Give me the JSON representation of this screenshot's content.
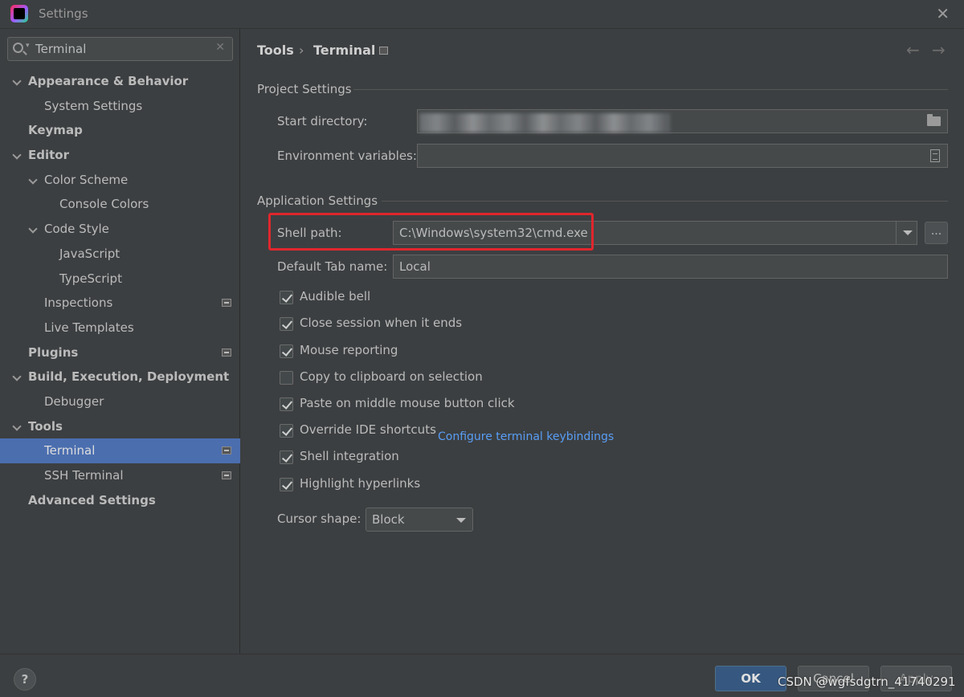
{
  "window": {
    "title": "Settings",
    "close_glyph": "✕"
  },
  "search": {
    "value": "Terminal",
    "placeholder": "",
    "clear_glyph": "✕"
  },
  "tree": [
    {
      "label": "Appearance & Behavior",
      "expanded": true
    },
    {
      "label": "System Settings"
    },
    {
      "label": "Keymap"
    },
    {
      "label": "Editor",
      "expanded": true
    },
    {
      "label": "Color Scheme",
      "expanded": true
    },
    {
      "label": "Console Colors"
    },
    {
      "label": "Code Style",
      "expanded": true
    },
    {
      "label": "JavaScript"
    },
    {
      "label": "TypeScript"
    },
    {
      "label": "Inspections"
    },
    {
      "label": "Live Templates"
    },
    {
      "label": "Plugins"
    },
    {
      "label": "Build, Execution, Deployment",
      "expanded": true
    },
    {
      "label": "Debugger"
    },
    {
      "label": "Tools",
      "expanded": true
    },
    {
      "label": "Terminal",
      "selected": true
    },
    {
      "label": "SSH Terminal"
    },
    {
      "label": "Advanced Settings"
    }
  ],
  "breadcrumb": {
    "parent": "Tools",
    "separator": "›",
    "current": "Terminal",
    "back_glyph": "←",
    "forward_glyph": "→"
  },
  "project_settings": {
    "title": "Project Settings",
    "start_directory_label": "Start directory:",
    "start_directory_value": "",
    "env_vars_label": "Environment variables:",
    "env_vars_value": ""
  },
  "app_settings": {
    "title": "Application Settings",
    "shell_path_label": "Shell path:",
    "shell_path_value": "C:\\Windows\\system32\\cmd.exe",
    "browse_label": "...",
    "default_tab_label": "Default Tab name:",
    "default_tab_value": "Local",
    "checkboxes": [
      {
        "label": "Audible bell",
        "checked": true
      },
      {
        "label": "Close session when it ends",
        "checked": true
      },
      {
        "label": "Mouse reporting",
        "checked": true
      },
      {
        "label": "Copy to clipboard on selection",
        "checked": false
      },
      {
        "label": "Paste on middle mouse button click",
        "checked": true
      },
      {
        "label": "Override IDE shortcuts",
        "checked": true
      },
      {
        "label": "Shell integration",
        "checked": true
      },
      {
        "label": "Highlight hyperlinks",
        "checked": true
      }
    ],
    "configure_link": "Configure terminal keybindings",
    "cursor_shape_label": "Cursor shape:",
    "cursor_shape_value": "Block"
  },
  "footer": {
    "help_label": "?",
    "ok_label": "OK",
    "cancel_label": "Cancel",
    "apply_label": "Apply"
  },
  "watermark": "CSDN @wgfsdgtrn_41740291",
  "colors": {
    "background": "#3c3f41",
    "selection": "#4b6eaf",
    "link": "#589df6",
    "highlight_box": "#e0262d",
    "ok_button": "#365880"
  }
}
